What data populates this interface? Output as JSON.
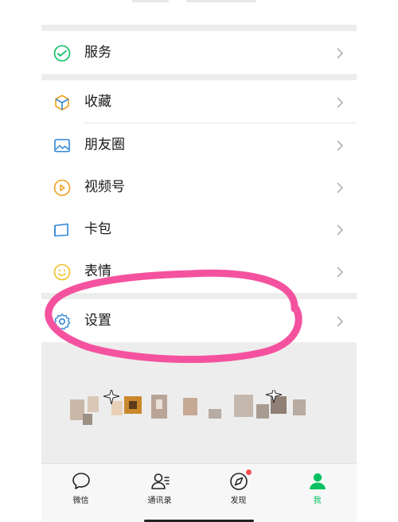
{
  "menu": {
    "items": [
      {
        "label": "服务",
        "icon": "wechat-pay-icon"
      },
      {
        "label": "收藏",
        "icon": "favorites-cube-icon"
      },
      {
        "label": "朋友圈",
        "icon": "moments-image-icon"
      },
      {
        "label": "视频号",
        "icon": "channels-play-icon"
      },
      {
        "label": "卡包",
        "icon": "card-wallet-icon"
      },
      {
        "label": "表情",
        "icon": "sticker-smile-icon"
      },
      {
        "label": "设置",
        "icon": "gear-icon"
      }
    ]
  },
  "tabbar": {
    "tabs": [
      {
        "label": "微信",
        "icon": "chat-bubble-icon",
        "active": false
      },
      {
        "label": "通讯录",
        "icon": "contacts-icon",
        "active": false
      },
      {
        "label": "发现",
        "icon": "compass-icon",
        "active": false,
        "badge": true
      },
      {
        "label": "我",
        "icon": "person-icon",
        "active": true
      }
    ]
  },
  "colors": {
    "accent_green": "#07c160",
    "badge_red": "#fa5151",
    "highlight_pink": "#f4529f",
    "icon_gray": "#8a8a8a"
  }
}
